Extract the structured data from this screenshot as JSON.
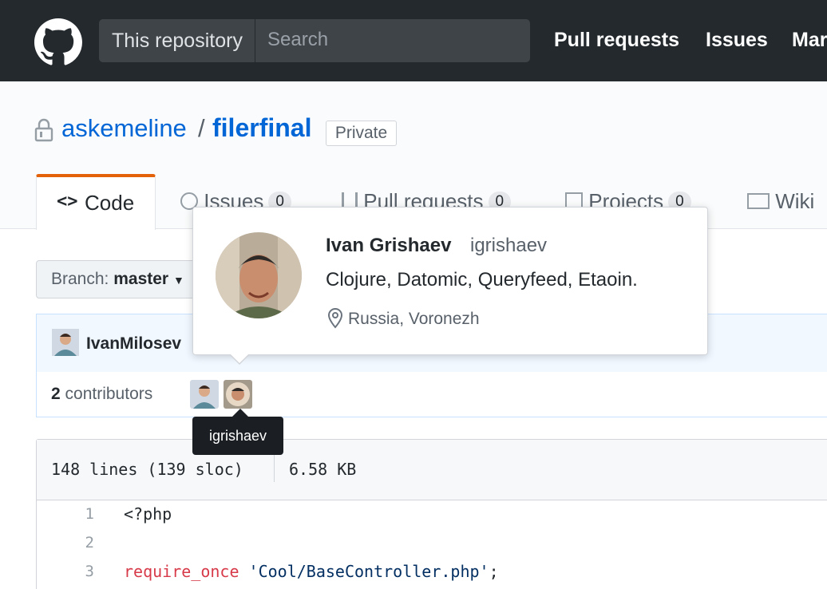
{
  "header": {
    "scope_label": "This repository",
    "search_placeholder": "Search",
    "nav": [
      "Pull requests",
      "Issues",
      "Mar"
    ]
  },
  "repo": {
    "owner": "askemeline",
    "separator": "/",
    "name": "filerfinal",
    "visibility": "Private"
  },
  "tabs": [
    {
      "label": "Code",
      "icon": "code-icon",
      "selected": true
    },
    {
      "label": "Issues",
      "count": "0",
      "icon": "issue-icon"
    },
    {
      "label": "Pull requests",
      "count": "0",
      "icon": "pull-request-icon"
    },
    {
      "label": "Projects",
      "count": "0",
      "icon": "project-icon"
    },
    {
      "label": "Wiki",
      "icon": "book-icon"
    }
  ],
  "branch": {
    "prefix": "Branch:",
    "name": "master"
  },
  "commit": {
    "author": "IvanMilosev"
  },
  "contributors": {
    "count": "2",
    "label": "contributors"
  },
  "tooltip": "igrishaev",
  "hovercard": {
    "name": "Ivan Grishaev",
    "login": "igrishaev",
    "bio": "Clojure, Datomic, Queryfeed, Etaoin.",
    "location": "Russia, Voronezh"
  },
  "file": {
    "lines_info": "148 lines (139 sloc)",
    "size": "6.58 KB",
    "lines": [
      {
        "num": "1",
        "text": "<?php"
      },
      {
        "num": "2",
        "text": ""
      },
      {
        "num": "3",
        "keyword": "require_once",
        "string": "'Cool/BaseController.php'",
        "end": ";"
      }
    ]
  },
  "colors": {
    "header_bg": "#24292e",
    "link": "#0366d6",
    "tab_accent": "#e36209",
    "keyword": "#d73a49",
    "string": "#032f62"
  }
}
